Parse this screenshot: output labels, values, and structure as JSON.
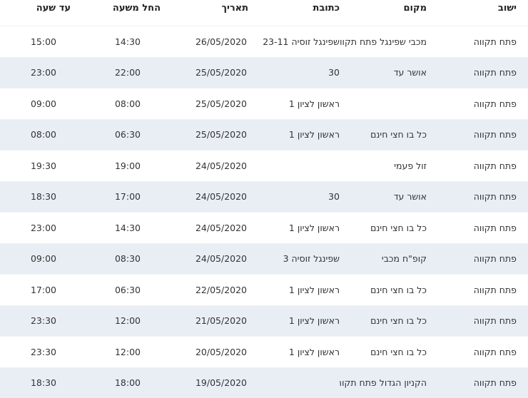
{
  "table": {
    "headers": [
      "ישוב",
      "מקום",
      "כתובת",
      "תאריך",
      "החל משעה",
      "עד שעה"
    ],
    "rows": [
      [
        "פתח תקווה",
        "מכבי שפינגל פתח תקווה",
        "שפינגל זוסיה 23-11",
        "26/05/2020",
        "14:30",
        "15:00"
      ],
      [
        "פתח תקווה",
        "אושר עד",
        "30",
        "25/05/2020",
        "22:00",
        "23:00"
      ],
      [
        "פתח תקווה",
        "",
        "ראשון לציון 1",
        "25/05/2020",
        "08:00",
        "09:00"
      ],
      [
        "פתח תקווה",
        "כל בו חצי חינם",
        "ראשון לציון 1",
        "25/05/2020",
        "06:30",
        "08:00"
      ],
      [
        "פתח תקווה",
        "זול פעמי",
        "",
        "24/05/2020",
        "19:00",
        "19:30"
      ],
      [
        "פתח תקווה",
        "אושר עד",
        "30",
        "24/05/2020",
        "17:00",
        "18:30"
      ],
      [
        "פתח תקווה",
        "כל בו חצי חינם",
        "ראשון לציון 1",
        "24/05/2020",
        "14:30",
        "23:00"
      ],
      [
        "פתח תקווה",
        "קופ\"ח מכבי",
        "שפינגל זוסיה 3",
        "24/05/2020",
        "08:30",
        "09:00"
      ],
      [
        "פתח תקווה",
        "כל בו חצי חינם",
        "ראשון לציון 1",
        "22/05/2020",
        "06:30",
        "17:00"
      ],
      [
        "פתח תקווה",
        "כל בו חצי חינם",
        "ראשון לציון 1",
        "21/05/2020",
        "12:00",
        "23:30"
      ],
      [
        "פתח תקווה",
        "כל בו חצי חינם",
        "ראשון לציון 1",
        "20/05/2020",
        "12:00",
        "23:30"
      ],
      [
        "פתח תקווה",
        "הקניון הגדול פתח תקוה",
        "",
        "19/05/2020",
        "18:00",
        "18:30"
      ]
    ]
  },
  "colors": {
    "row_alt": "#e9eef5",
    "row": "#ffffff",
    "text": "#333333"
  }
}
